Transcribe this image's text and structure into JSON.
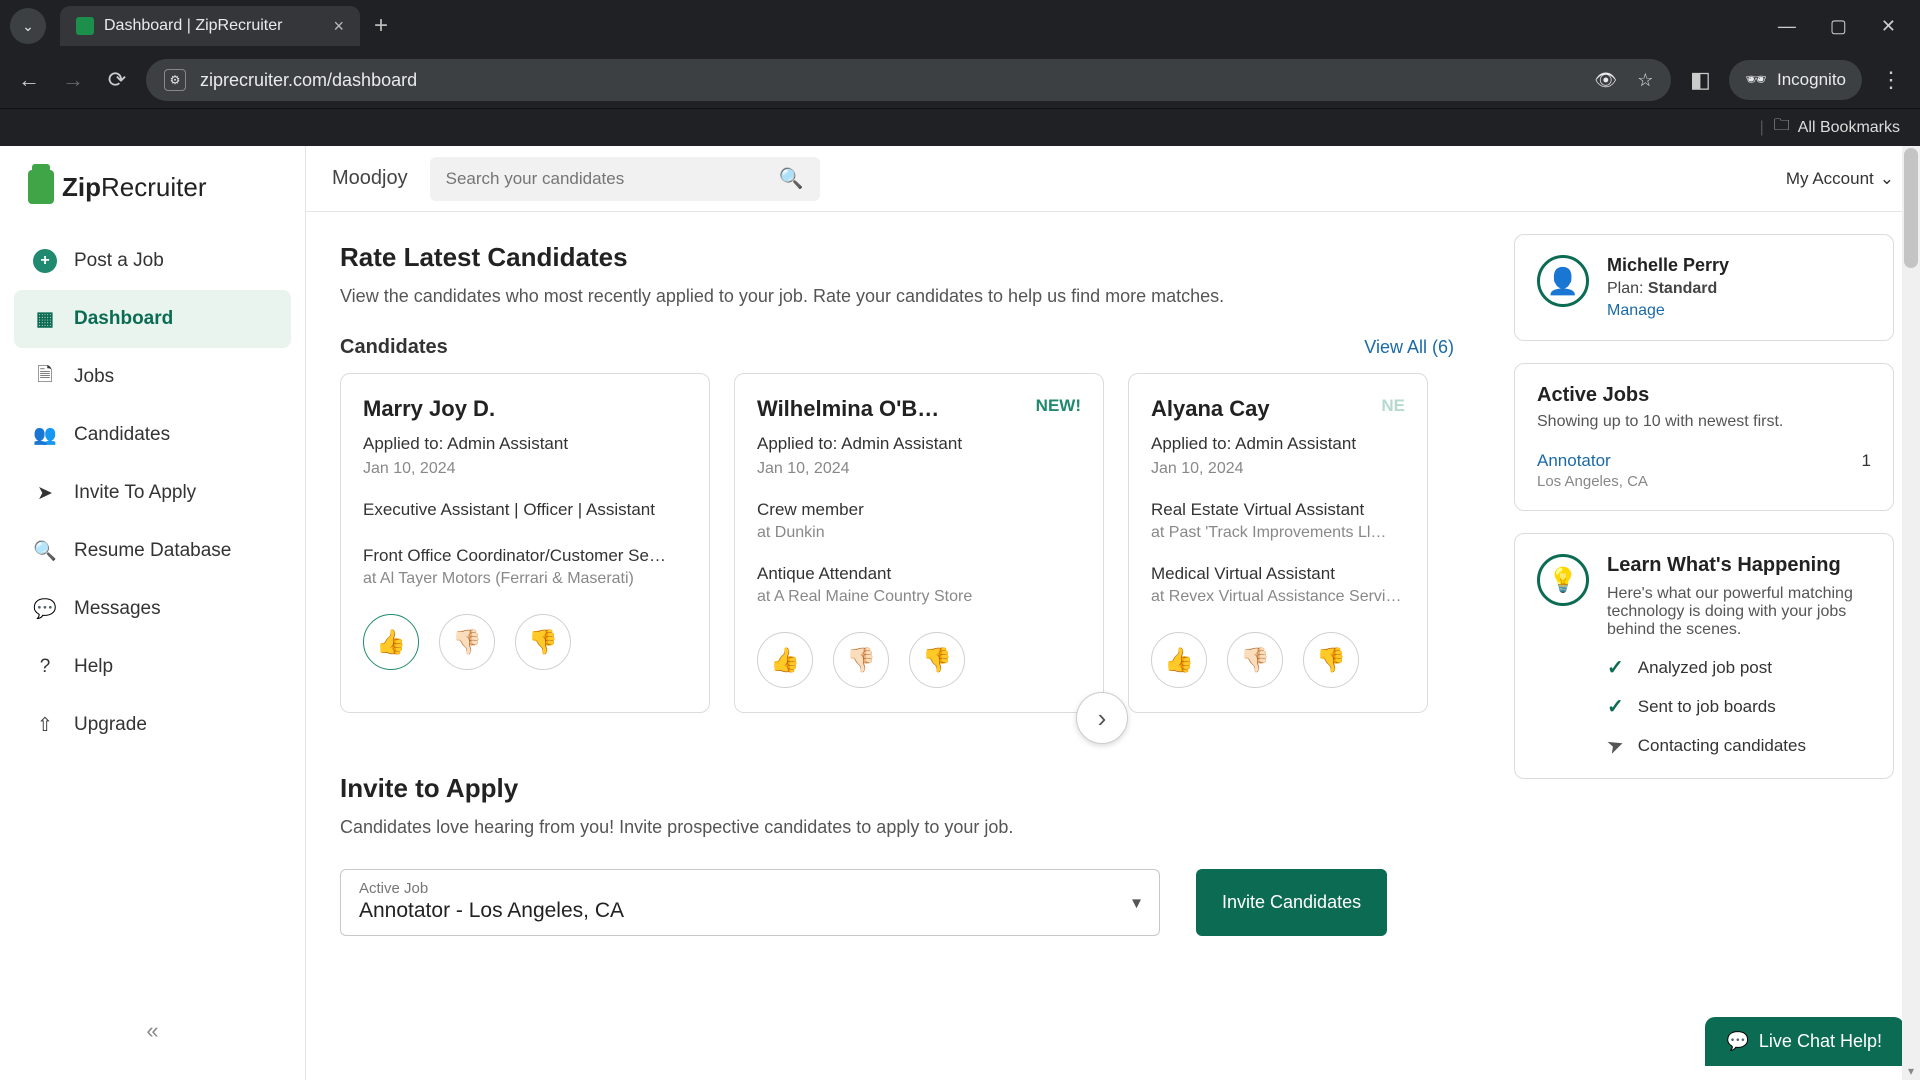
{
  "browser": {
    "tab_title": "Dashboard | ZipRecruiter",
    "url": "ziprecruiter.com/dashboard",
    "incognito_label": "Incognito",
    "all_bookmarks": "All Bookmarks"
  },
  "brand": {
    "name_a": "Zip",
    "name_b": "Recruiter"
  },
  "sidebar": {
    "items": [
      {
        "label": "Post a Job"
      },
      {
        "label": "Dashboard"
      },
      {
        "label": "Jobs"
      },
      {
        "label": "Candidates"
      },
      {
        "label": "Invite To Apply"
      },
      {
        "label": "Resume Database"
      },
      {
        "label": "Messages"
      },
      {
        "label": "Help"
      },
      {
        "label": "Upgrade"
      }
    ]
  },
  "topbar": {
    "org": "Moodjoy",
    "search_placeholder": "Search your candidates",
    "account_label": "My Account"
  },
  "rate": {
    "title": "Rate Latest Candidates",
    "subtitle": "View the candidates who most recently applied to your job. Rate your candidates to help us find more matches.",
    "section_label": "Candidates",
    "view_all": "View All (6)"
  },
  "cards": [
    {
      "name": "Marry Joy D.",
      "badge": "",
      "applied_to": "Applied to: Admin Assistant",
      "date": "Jan 10, 2024",
      "exp1_title": "Executive Assistant | Officer | Assistant",
      "exp1_sub": "",
      "exp2_title": "Front Office Coordinator/Customer Se…",
      "exp2_sub": "at Al Tayer Motors (Ferrari & Maserati)"
    },
    {
      "name": "Wilhelmina O'B…",
      "badge": "NEW!",
      "applied_to": "Applied to: Admin Assistant",
      "date": "Jan 10, 2024",
      "exp1_title": "Crew member",
      "exp1_sub": "at Dunkin",
      "exp2_title": "Antique Attendant",
      "exp2_sub": "at A Real Maine Country Store"
    },
    {
      "name": "Alyana Cay",
      "badge": "NE",
      "applied_to": "Applied to: Admin Assistant",
      "date": "Jan 10, 2024",
      "exp1_title": "Real Estate Virtual Assistant",
      "exp1_sub": "at Past 'Track Improvements Ll…",
      "exp2_title": "Medical Virtual Assistant",
      "exp2_sub": "at Revex Virtual Assistance Service…"
    }
  ],
  "invite": {
    "title": "Invite to Apply",
    "subtitle": "Candidates love hearing from you! Invite prospective candidates to apply to your job.",
    "select_label": "Active Job",
    "select_value": "Annotator - Los Angeles, CA",
    "button": "Invite Candidates"
  },
  "user_panel": {
    "name": "Michelle Perry",
    "plan_prefix": "Plan: ",
    "plan_value": "Standard",
    "manage": "Manage"
  },
  "active_jobs": {
    "title": "Active Jobs",
    "subtitle": "Showing up to 10 with newest first.",
    "job_name": "Annotator",
    "job_loc": "Los Angeles, CA",
    "count": "1"
  },
  "learn": {
    "title": "Learn What's Happening",
    "subtitle": "Here's what our powerful matching technology is doing with your jobs behind the scenes.",
    "items": [
      "Analyzed job post",
      "Sent to job boards",
      "Contacting candidates"
    ]
  },
  "chat": {
    "label": "Live Chat Help!"
  }
}
